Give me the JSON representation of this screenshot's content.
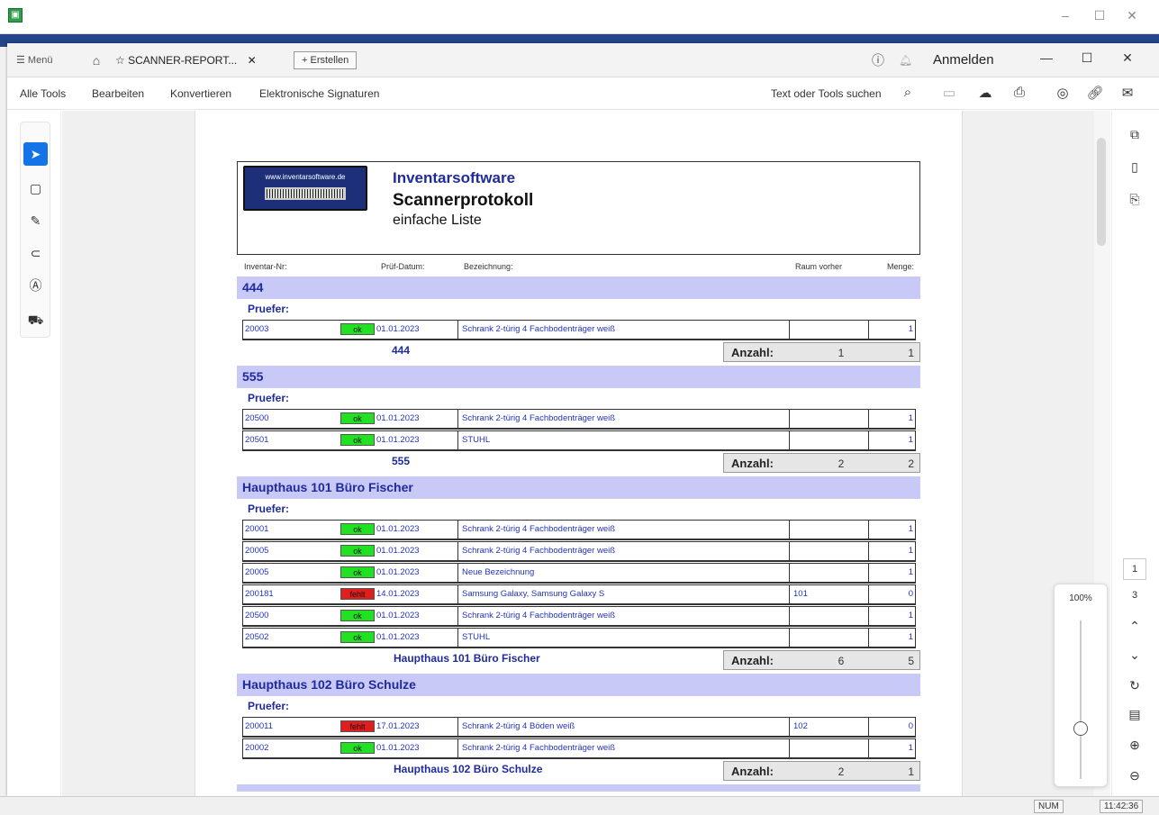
{
  "window": {
    "time": "11:42:36",
    "num": "NUM"
  },
  "tabbar": {
    "menu": "☰ Menü",
    "doc_tab": "SCANNER-REPORT...",
    "new_tab": "+ Erstellen",
    "login": "Anmelden"
  },
  "toolbar": {
    "items": [
      "Alle Tools",
      "Bearbeiten",
      "Konvertieren",
      "Elektronische Signaturen"
    ],
    "search": "Text oder Tools suchen"
  },
  "zoom": "100%",
  "page_nav": {
    "current": "1",
    "total": "3"
  },
  "report": {
    "logo_url": "www.inventarsoftware.de",
    "brand": "Inventarsoftware",
    "title": "Scannerprotokoll",
    "subtitle": "einfache Liste",
    "columns": [
      "Inventar-Nr:",
      "Prüf-Datum:",
      "Bezeichnung:",
      "Raum vorher",
      "Menge:"
    ],
    "pruefer": "Pruefer:",
    "anzahl": "Anzahl:",
    "groups": [
      {
        "name": "444",
        "rows": [
          {
            "inv": "20003",
            "status": "ok",
            "date": "01.01.2023",
            "desc": "Schrank 2-türig 4 Fachbodenträger weiß",
            "room": "",
            "qty": "1"
          }
        ],
        "count": "1",
        "qty": "1"
      },
      {
        "name": "555",
        "rows": [
          {
            "inv": "20500",
            "status": "ok",
            "date": "01.01.2023",
            "desc": "Schrank 2-türig 4 Fachbodenträger weiß",
            "room": "",
            "qty": "1"
          },
          {
            "inv": "20501",
            "status": "ok",
            "date": "01.01.2023",
            "desc": "STUHL",
            "room": "",
            "qty": "1"
          }
        ],
        "count": "2",
        "qty": "2"
      },
      {
        "name": "Haupthaus 101 Büro Fischer",
        "rows": [
          {
            "inv": "20001",
            "status": "ok",
            "date": "01.01.2023",
            "desc": "Schrank 2-türig 4 Fachbodenträger weiß",
            "room": "",
            "qty": "1"
          },
          {
            "inv": "20005",
            "status": "ok",
            "date": "01.01.2023",
            "desc": "Schrank 2-türig 4 Fachbodenträger weiß",
            "room": "",
            "qty": "1"
          },
          {
            "inv": "20005",
            "status": "ok",
            "date": "01.01.2023",
            "desc": "Neue Bezeichnung",
            "room": "",
            "qty": "1"
          },
          {
            "inv": "200181",
            "status": "fehlt",
            "date": "14.01.2023",
            "desc": "Samsung Galaxy, Samsung Galaxy S",
            "room": "101",
            "qty": "0"
          },
          {
            "inv": "20500",
            "status": "ok",
            "date": "01.01.2023",
            "desc": "Schrank 2-türig 4 Fachbodenträger weiß",
            "room": "",
            "qty": "1"
          },
          {
            "inv": "20502",
            "status": "ok",
            "date": "01.01.2023",
            "desc": "STUHL",
            "room": "",
            "qty": "1"
          }
        ],
        "count": "6",
        "qty": "5"
      },
      {
        "name": "Haupthaus 102 Büro  Schulze",
        "rows": [
          {
            "inv": "200011",
            "status": "fehlt",
            "date": "17.01.2023",
            "desc": "Schrank 2-türig 4 Böden weiß",
            "room": "102",
            "qty": "0"
          },
          {
            "inv": "20002",
            "status": "ok",
            "date": "01.01.2023",
            "desc": "Schrank 2-türig 4 Fachbodenträger weiß",
            "room": "",
            "qty": "1"
          }
        ],
        "count": "2",
        "qty": "1"
      }
    ]
  }
}
